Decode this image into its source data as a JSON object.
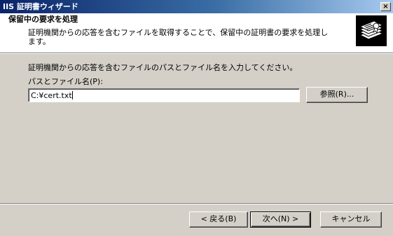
{
  "window": {
    "title": "IIS 証明書ウィザード",
    "close_glyph": "×"
  },
  "header": {
    "title": "保留中の要求を処理",
    "description": "証明機関からの応答を含むファイルを取得することで、保留中の証明書の要求を処理します。",
    "icon": "certificate-wizard-icon"
  },
  "body": {
    "instruction": "証明機関からの応答を含むファイルのパスとファイル名を入力してください。",
    "path_label": "パスとファイル名(P):",
    "path_value": "C:¥cert.txt",
    "browse_label": "参照(R)..."
  },
  "footer": {
    "back_label": "< 戻る(B)",
    "next_label": "次へ(N) >",
    "cancel_label": "キャンセル"
  }
}
